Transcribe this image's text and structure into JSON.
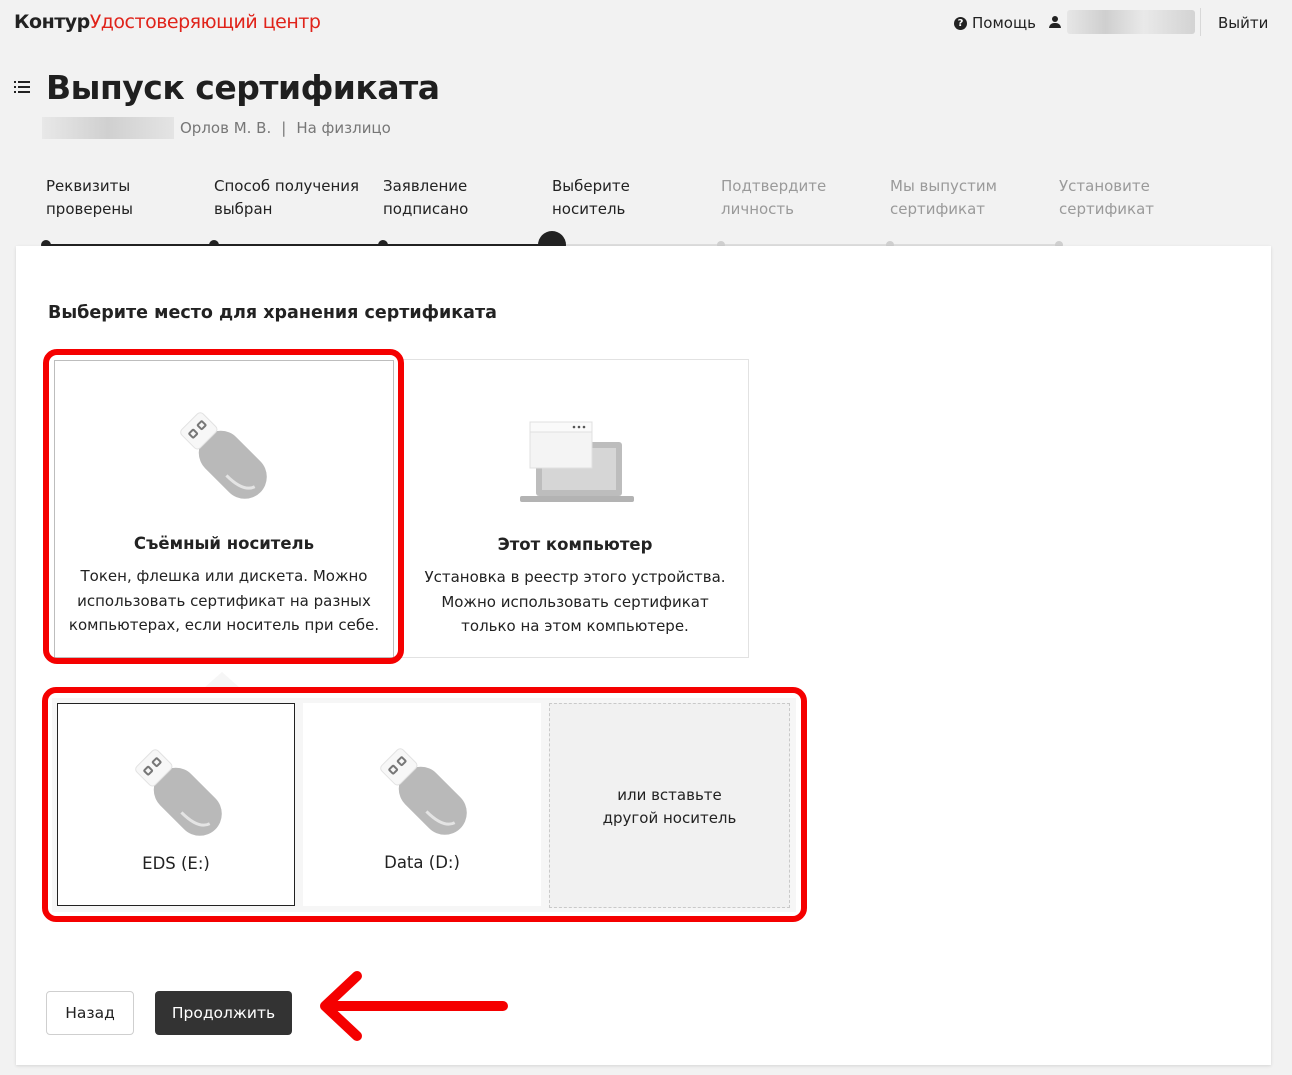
{
  "header": {
    "brand_main": "Контур",
    "brand_product": "Удостоверяющий центр",
    "help_label": "Помощь",
    "logout_label": "Выйти"
  },
  "page": {
    "title": "Выпуск сертификата",
    "owner": "Орлов М. В.",
    "separator": "|",
    "cert_type": "На физлицо"
  },
  "steps": [
    {
      "line1": "Реквизиты",
      "line2": "проверены",
      "state": "done"
    },
    {
      "line1": "Способ получения",
      "line2": "выбран",
      "state": "done"
    },
    {
      "line1": "Заявление",
      "line2": "подписано",
      "state": "done"
    },
    {
      "line1": "Выберите",
      "line2": "носитель",
      "state": "current"
    },
    {
      "line1": "Подтвердите",
      "line2": "личность",
      "state": "todo"
    },
    {
      "line1": "Мы выпустим",
      "line2": "сертификат",
      "state": "todo"
    },
    {
      "line1": "Установите",
      "line2": "сертификат",
      "state": "todo"
    }
  ],
  "storage": {
    "heading": "Выберите место для хранения сертификата",
    "options": [
      {
        "title": "Съёмный носитель",
        "desc1": "Токен, флешка или дискета. Можно",
        "desc2": "использовать сертификат на разных",
        "desc3": "компьютерах, если носитель при себе.",
        "icon": "usb-drive-icon",
        "selected": true
      },
      {
        "title": "Этот компьютер",
        "desc1": "Установка в реестр этого устройства.",
        "desc2": "Можно использовать сертификат",
        "desc3": "только на этом компьютере.",
        "icon": "laptop-window-icon",
        "selected": false
      }
    ],
    "drives": [
      {
        "label": "EDS (E:)",
        "selected": true
      },
      {
        "label": "Data (D:)",
        "selected": false
      }
    ],
    "insert_line1": "или вставьте",
    "insert_line2": "другой носитель"
  },
  "buttons": {
    "back": "Назад",
    "next": "Продолжить"
  },
  "colors": {
    "brand_red": "#e0231a",
    "annotation_red": "#f50000",
    "primary_button": "#333333"
  }
}
